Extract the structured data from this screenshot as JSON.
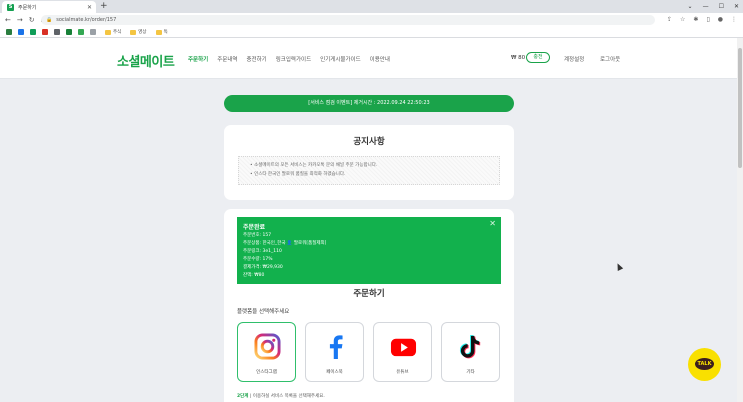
{
  "browser": {
    "tab_title": "주문하기",
    "new_tab": "+",
    "url": "socialmate.kr/order/157",
    "bookmark_folders": [
      "주식",
      "영상",
      "독"
    ]
  },
  "header": {
    "logo": "소셜메이트",
    "nav": [
      "주문하기",
      "주문내역",
      "충전하기",
      "링크입력가이드",
      "인기게시물가이드",
      "이용안내"
    ],
    "balance": "₩ 80",
    "charge_label": "충전",
    "account_label": "계정설정",
    "logout_label": "로그아웃"
  },
  "banner": {
    "text": "[서비스 점검 이벤트] 제거시간 : 2022.09.24 22:50:23"
  },
  "notice": {
    "title": "공지사항",
    "lines": [
      "• 소셜메이트의 모든 서비스는 카카오톡 문의 채널 주문 가능합니다.",
      "• 인스타 한국인 팔로워 품질을 최적화 하였습니다."
    ]
  },
  "toast": {
    "title": "주문완료",
    "lines": [
      "주문번호: 157",
      "주문상품: 한국인_한국 👤 팔로워[품질제외]",
      "주문링크: 3e1_110",
      "주문수량: 17%",
      "결제가격: ₩29,930",
      "잔액: ₩80"
    ],
    "close": "✕"
  },
  "order": {
    "title": "주문하기",
    "platform_prompt": "플랫폼을 선택해주세요",
    "platforms": [
      {
        "label": "인스타그램",
        "icon": "instagram-icon",
        "selected": true
      },
      {
        "label": "페이스북",
        "icon": "facebook-icon",
        "selected": false
      },
      {
        "label": "유튜브",
        "icon": "youtube-icon",
        "selected": false
      },
      {
        "label": "기타",
        "icon": "tiktok-icon",
        "selected": false
      }
    ],
    "step_label": "2단계",
    "step_text": "이용하실 서비스 목록을 선택해주세요."
  },
  "kakao": {
    "label": "TALK"
  },
  "colors": {
    "brand_green": "#1aa34a",
    "toast_green": "#12b14d",
    "kakao_yellow": "#f9e000"
  }
}
